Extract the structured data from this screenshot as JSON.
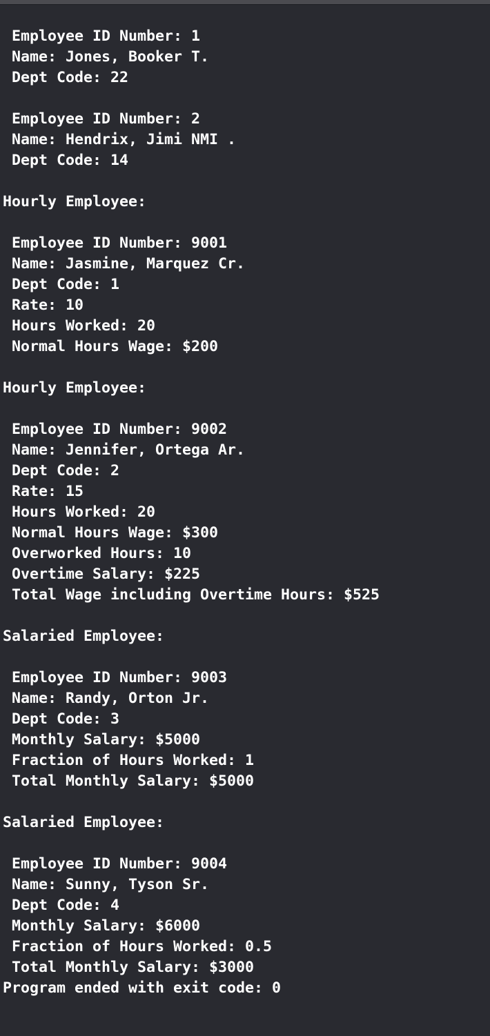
{
  "console": {
    "lines": [
      " Employee ID Number: 1",
      " Name: Jones, Booker T.",
      " Dept Code: 22",
      "",
      " Employee ID Number: 2",
      " Name: Hendrix, Jimi NMI .",
      " Dept Code: 14",
      "",
      "Hourly Employee:",
      "",
      " Employee ID Number: 9001",
      " Name: Jasmine, Marquez Cr.",
      " Dept Code: 1",
      " Rate: 10",
      " Hours Worked: 20",
      " Normal Hours Wage: $200",
      "",
      "Hourly Employee:",
      "",
      " Employee ID Number: 9002",
      " Name: Jennifer, Ortega Ar.",
      " Dept Code: 2",
      " Rate: 15",
      " Hours Worked: 20",
      " Normal Hours Wage: $300",
      " Overworked Hours: 10",
      " Overtime Salary: $225",
      " Total Wage including Overtime Hours: $525",
      "",
      "Salaried Employee:",
      "",
      " Employee ID Number: 9003",
      " Name: Randy, Orton Jr.",
      " Dept Code: 3",
      " Monthly Salary: $5000",
      " Fraction of Hours Worked: 1",
      " Total Monthly Salary: $5000",
      "",
      "Salaried Employee:",
      "",
      " Employee ID Number: 9004",
      " Name: Sunny, Tyson Sr.",
      " Dept Code: 4",
      " Monthly Salary: $6000",
      " Fraction of Hours Worked: 0.5",
      " Total Monthly Salary: $3000",
      "Program ended with exit code: 0"
    ]
  },
  "colors": {
    "background": "#292a30",
    "text": "#ffffff"
  }
}
